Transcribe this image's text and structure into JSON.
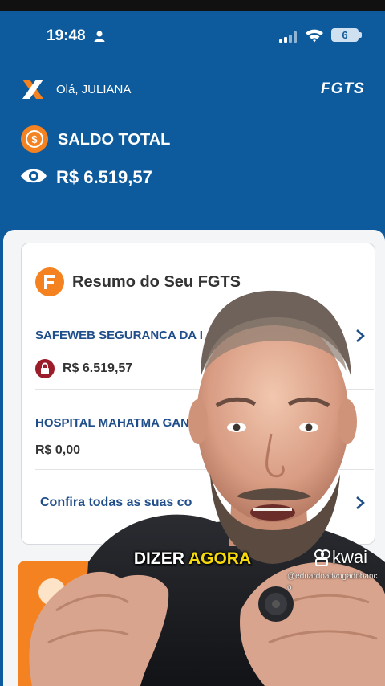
{
  "status_bar": {
    "time": "19:48",
    "battery": "6"
  },
  "header": {
    "greeting": "Olá, JULIANA",
    "brand": "FGTS",
    "saldo_title": "SALDO TOTAL",
    "saldo_value": "R$ 6.519,57"
  },
  "summary_card": {
    "title": "Resumo do Seu FGTS",
    "employers": [
      {
        "name": "SAFEWEB SEGURANCA DA I",
        "value": "R$ 6.519,57",
        "locked": true
      },
      {
        "name": "HOSPITAL MAHATMA GAN",
        "value": "R$ 0,00",
        "locked": false
      }
    ],
    "link_label": "Confira todas as suas co"
  },
  "overlay": {
    "caption_part1": "DIZER",
    "caption_part2": "AGORA",
    "watermark": "kwai",
    "handle": "@eduardoadvogadobanco"
  },
  "colors": {
    "primary_blue": "#0d5a9c",
    "accent_orange": "#f58220",
    "link_blue": "#1f4e8a",
    "lock_red": "#9c1d2a",
    "caption_highlight": "#f5d90a"
  },
  "icons": [
    "person-icon",
    "signal-icon",
    "wifi-icon",
    "caixa-logo",
    "saldo-sync-icon",
    "eye-icon",
    "fgts-doc-icon",
    "lock-icon",
    "chevron-right-icon",
    "kwai-logo"
  ]
}
